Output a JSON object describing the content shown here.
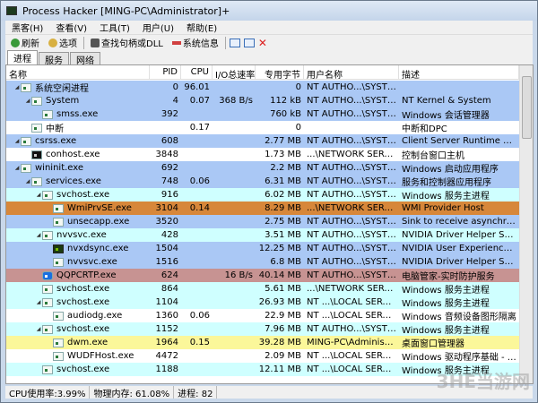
{
  "title": "Process Hacker [MING-PC\\Administrator]+",
  "menu": [
    "黑客(H)",
    "查看(V)",
    "工具(T)",
    "用户(U)",
    "帮助(E)"
  ],
  "toolbar": {
    "refresh": "刷新",
    "options": "选项",
    "find": "查找句柄或DLL",
    "sysinfo": "系统信息"
  },
  "tabs": [
    "进程",
    "服务",
    "网络"
  ],
  "columns": [
    "名称",
    "PID",
    "CPU",
    "I/O总速率",
    "专用字节",
    "用户名称",
    "描述"
  ],
  "colors": {
    "blue": "#aac8f5",
    "cyan": "#cfffff",
    "orange": "#d7873a",
    "brown": "#c79392",
    "yellow": "#fbf79a",
    "white": "#ffffff"
  },
  "rows": [
    {
      "name": "系统空闲进程",
      "pid": "0",
      "cpu": "96.01",
      "io": "",
      "priv": "0",
      "user": "NT AUTHO...\\SYSTEM",
      "desc": "",
      "depth": 0,
      "exp": true,
      "color": "blue",
      "icon": "app"
    },
    {
      "name": "System",
      "pid": "4",
      "cpu": "0.07",
      "io": "368 B/s",
      "priv": "112 kB",
      "user": "NT AUTHO...\\SYSTEM",
      "desc": "NT Kernel & System",
      "depth": 1,
      "exp": true,
      "color": "blue",
      "icon": "app"
    },
    {
      "name": "smss.exe",
      "pid": "392",
      "cpu": "",
      "io": "",
      "priv": "760 kB",
      "user": "NT AUTHO...\\SYSTEM",
      "desc": "Windows 会话管理器",
      "depth": 2,
      "exp": false,
      "color": "blue",
      "icon": "app"
    },
    {
      "name": "中断",
      "pid": "",
      "cpu": "0.17",
      "io": "",
      "priv": "0",
      "user": "",
      "desc": "中断和DPC",
      "depth": 1,
      "exp": false,
      "color": "white",
      "icon": "app"
    },
    {
      "name": "csrss.exe",
      "pid": "608",
      "cpu": "",
      "io": "",
      "priv": "2.77 MB",
      "user": "NT AUTHO...\\SYSTEM",
      "desc": "Client Server Runtime Proc...",
      "depth": 0,
      "exp": true,
      "color": "blue",
      "icon": "app"
    },
    {
      "name": "conhost.exe",
      "pid": "3848",
      "cpu": "",
      "io": "",
      "priv": "1.73 MB",
      "user": "...\\NETWORK SERVICE",
      "desc": "控制台窗口主机",
      "depth": 1,
      "exp": false,
      "color": "white",
      "icon": "con"
    },
    {
      "name": "wininit.exe",
      "pid": "692",
      "cpu": "",
      "io": "",
      "priv": "2.2 MB",
      "user": "NT AUTHO...\\SYSTEM",
      "desc": "Windows 启动应用程序",
      "depth": 0,
      "exp": true,
      "color": "blue",
      "icon": "app"
    },
    {
      "name": "services.exe",
      "pid": "748",
      "cpu": "0.06",
      "io": "",
      "priv": "6.31 MB",
      "user": "NT AUTHO...\\SYSTEM",
      "desc": "服务和控制器应用程序",
      "depth": 1,
      "exp": true,
      "color": "blue",
      "icon": "app"
    },
    {
      "name": "svchost.exe",
      "pid": "916",
      "cpu": "",
      "io": "",
      "priv": "6.02 MB",
      "user": "NT AUTHO...\\SYSTEM",
      "desc": "Windows 服务主进程",
      "depth": 2,
      "exp": true,
      "color": "cyan",
      "icon": "app"
    },
    {
      "name": "WmiPrvSE.exe",
      "pid": "3104",
      "cpu": "0.14",
      "io": "",
      "priv": "8.29 MB",
      "user": "...\\NETWORK SERVICE",
      "desc": "WMI Provider Host",
      "depth": 3,
      "exp": false,
      "color": "orange",
      "icon": "app"
    },
    {
      "name": "unsecapp.exe",
      "pid": "3520",
      "cpu": "",
      "io": "",
      "priv": "2.75 MB",
      "user": "NT AUTHO...\\SYSTEM",
      "desc": "Sink to receive asynchrono...",
      "depth": 3,
      "exp": false,
      "color": "blue",
      "icon": "app"
    },
    {
      "name": "nvvsvc.exe",
      "pid": "428",
      "cpu": "",
      "io": "",
      "priv": "3.51 MB",
      "user": "NT AUTHO...\\SYSTEM",
      "desc": "NVIDIA Driver Helper Servi...",
      "depth": 2,
      "exp": true,
      "color": "cyan",
      "icon": "app"
    },
    {
      "name": "nvxdsync.exe",
      "pid": "1504",
      "cpu": "",
      "io": "",
      "priv": "12.25 MB",
      "user": "NT AUTHO...\\SYSTEM",
      "desc": "NVIDIA User Experience Dr...",
      "depth": 3,
      "exp": false,
      "color": "blue",
      "icon": "nv"
    },
    {
      "name": "nvvsvc.exe",
      "pid": "1516",
      "cpu": "",
      "io": "",
      "priv": "6.8 MB",
      "user": "NT AUTHO...\\SYSTEM",
      "desc": "NVIDIA Driver Helper Servi...",
      "depth": 3,
      "exp": false,
      "color": "blue",
      "icon": "app"
    },
    {
      "name": "QQPCRTP.exe",
      "pid": "624",
      "cpu": "",
      "io": "16 B/s",
      "priv": "40.14 MB",
      "user": "NT AUTHO...\\SYSTEM",
      "desc": "电脑管家-实时防护服务",
      "depth": 2,
      "exp": false,
      "color": "brown",
      "icon": "qq"
    },
    {
      "name": "svchost.exe",
      "pid": "864",
      "cpu": "",
      "io": "",
      "priv": "5.61 MB",
      "user": "...\\NETWORK SERVICE",
      "desc": "Windows 服务主进程",
      "depth": 2,
      "exp": false,
      "color": "cyan",
      "icon": "app"
    },
    {
      "name": "svchost.exe",
      "pid": "1104",
      "cpu": "",
      "io": "",
      "priv": "26.93 MB",
      "user": "NT ...\\LOCAL SERVICE",
      "desc": "Windows 服务主进程",
      "depth": 2,
      "exp": true,
      "color": "cyan",
      "icon": "app"
    },
    {
      "name": "audiodg.exe",
      "pid": "1360",
      "cpu": "0.06",
      "io": "",
      "priv": "22.9 MB",
      "user": "NT ...\\LOCAL SERVICE",
      "desc": "Windows 音频设备图形隔离",
      "depth": 3,
      "exp": false,
      "color": "white",
      "icon": "app"
    },
    {
      "name": "svchost.exe",
      "pid": "1152",
      "cpu": "",
      "io": "",
      "priv": "7.96 MB",
      "user": "NT AUTHO...\\SYSTEM",
      "desc": "Windows 服务主进程",
      "depth": 2,
      "exp": true,
      "color": "cyan",
      "icon": "app"
    },
    {
      "name": "dwm.exe",
      "pid": "1964",
      "cpu": "0.15",
      "io": "",
      "priv": "39.28 MB",
      "user": "MING-PC\\Administrat",
      "desc": "桌面窗口管理器",
      "depth": 3,
      "exp": false,
      "color": "yellow",
      "icon": "app"
    },
    {
      "name": "WUDFHost.exe",
      "pid": "4472",
      "cpu": "",
      "io": "",
      "priv": "2.09 MB",
      "user": "NT ...\\LOCAL SERVICE",
      "desc": "Windows 驱动程序基础 - 用...",
      "depth": 3,
      "exp": false,
      "color": "white",
      "icon": "app"
    },
    {
      "name": "svchost.exe",
      "pid": "1188",
      "cpu": "",
      "io": "",
      "priv": "12.11 MB",
      "user": "NT ...\\LOCAL SERVICE",
      "desc": "Windows 服务主进程",
      "depth": 2,
      "exp": false,
      "color": "cyan",
      "icon": "app"
    }
  ],
  "status": {
    "cpu": "CPU使用率:3.99%",
    "mem": "物理内存: 61.08%",
    "proc": "进程: 82"
  },
  "watermark": "3HE当游网"
}
